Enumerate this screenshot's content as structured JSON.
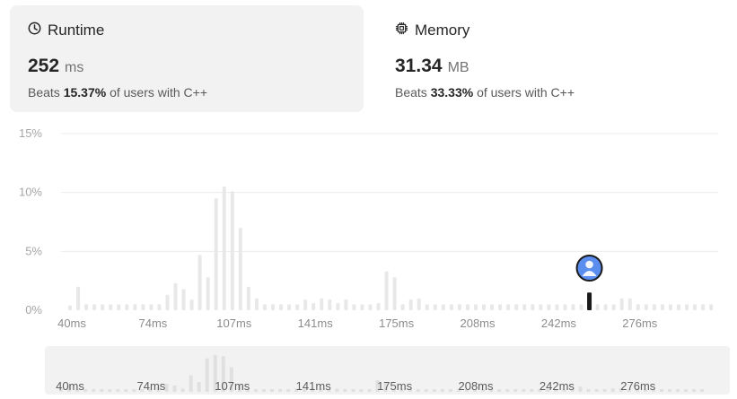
{
  "runtime": {
    "title": "Runtime",
    "value": "252",
    "unit": "ms",
    "beats_prefix": "Beats",
    "beats_pct": "15.37%",
    "beats_suffix": "of users with C++"
  },
  "memory": {
    "title": "Memory",
    "value": "31.34",
    "unit": "MB",
    "beats_prefix": "Beats",
    "beats_pct": "33.33%",
    "beats_suffix": "of users with C++"
  },
  "chart_data": {
    "type": "bar",
    "title": "",
    "xlabel": "",
    "ylabel": "",
    "ylim": [
      0,
      15
    ],
    "yticks": [
      "0%",
      "5%",
      "10%",
      "15%"
    ],
    "xticks": [
      "40ms",
      "74ms",
      "107ms",
      "141ms",
      "175ms",
      "208ms",
      "242ms",
      "276ms"
    ],
    "grid": true,
    "values": [
      0.4,
      2.0,
      0.5,
      0.5,
      0.5,
      0.5,
      0.5,
      0.5,
      0.5,
      0.5,
      0.5,
      0.5,
      1.3,
      2.3,
      1.8,
      0.9,
      4.7,
      2.8,
      9.5,
      10.5,
      10.1,
      7.0,
      2.0,
      1.0,
      0.5,
      0.5,
      0.5,
      0.5,
      0.5,
      0.9,
      0.6,
      1.0,
      0.9,
      0.6,
      0.9,
      0.5,
      0.5,
      0.5,
      0.6,
      3.3,
      2.8,
      0.5,
      0.9,
      1.0,
      0.5,
      0.5,
      0.5,
      0.5,
      0.5,
      0.5,
      0.5,
      0.5,
      0.5,
      0.5,
      0.5,
      0.5,
      0.5,
      0.5,
      0.5,
      0.5,
      0.5,
      0.5,
      0.5,
      0.5,
      1.5,
      0.5,
      0.5,
      0.5,
      1.0,
      1.0,
      0.5,
      0.5,
      0.5,
      0.5,
      0.5,
      0.5,
      0.5,
      0.5,
      0.5,
      0.5
    ],
    "highlight_index": 64,
    "colors": {
      "bar": "#e8e8e8",
      "highlight": "#1a1a1a",
      "avatar": "#5b8def",
      "grid": "#ececec",
      "minimap_bg": "#f2f2f2",
      "tick": "#8c8c8c"
    }
  }
}
